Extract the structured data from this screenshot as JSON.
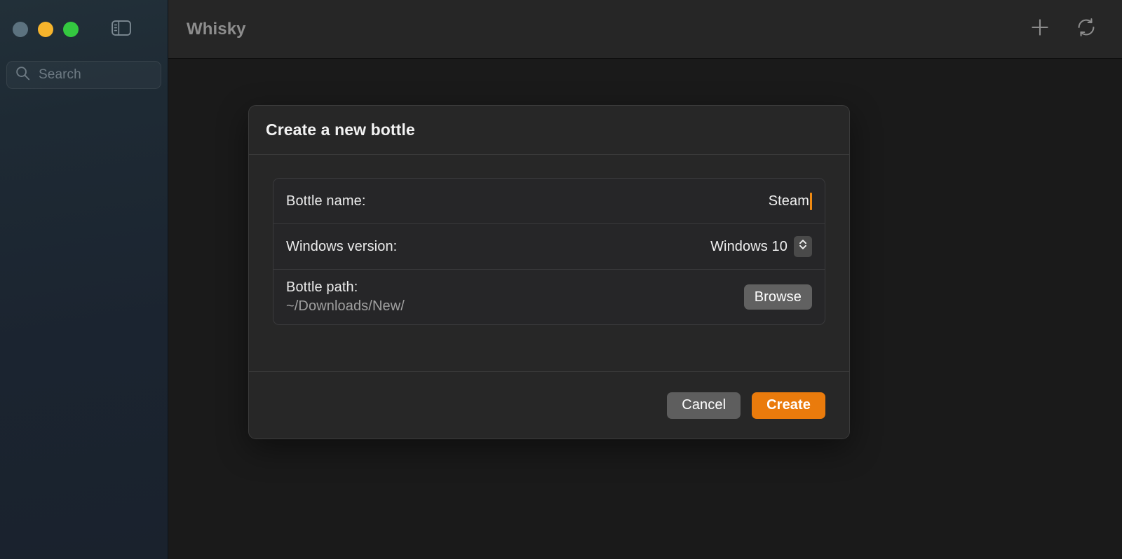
{
  "window": {
    "traffic_lights": [
      {
        "name": "close",
        "color": "#5c727f"
      },
      {
        "name": "minimize",
        "color": "#f6b42c"
      },
      {
        "name": "maximize",
        "color": "#34c840"
      }
    ]
  },
  "sidebar": {
    "toggle_icon": "sidebar-toggle-icon",
    "search": {
      "icon": "search-icon",
      "placeholder": "Search",
      "value": ""
    }
  },
  "toolbar": {
    "title": "Whisky",
    "actions": [
      {
        "name": "add-bottle",
        "icon": "plus-icon"
      },
      {
        "name": "refresh",
        "icon": "refresh-icon"
      }
    ]
  },
  "dialog": {
    "title": "Create a new bottle",
    "fields": {
      "bottle_name": {
        "label": "Bottle name:",
        "value": "Steam",
        "has_caret": true
      },
      "windows_version": {
        "label": "Windows version:",
        "value": "Windows 10",
        "stepper_icon": "chevron-up-down-icon"
      },
      "bottle_path": {
        "label": "Bottle path:",
        "value": "~/Downloads/New/",
        "browse_label": "Browse"
      }
    },
    "buttons": {
      "cancel": "Cancel",
      "create": "Create"
    }
  },
  "colors": {
    "accent": "#ea7b0c",
    "caret": "#f08a12",
    "sidebar_bg": "#1e2a34",
    "main_bg": "#1a1a1a",
    "dialog_bg": "#272727",
    "toolbar_bg": "#262626"
  }
}
